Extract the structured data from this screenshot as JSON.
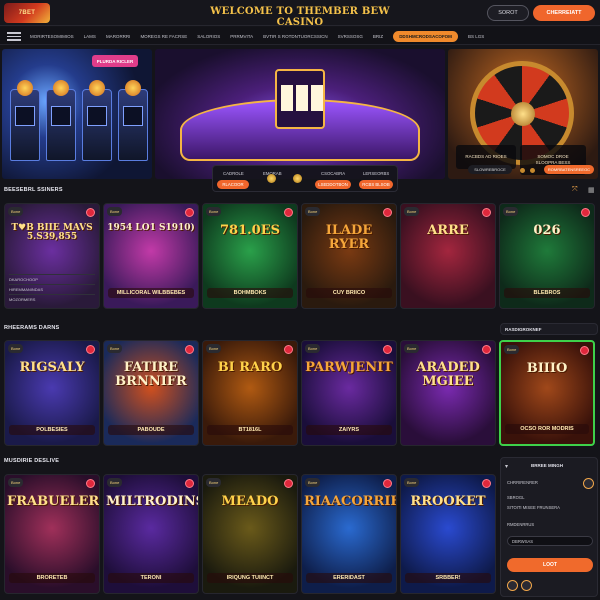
{
  "header": {
    "logo_text": "7BET",
    "title": "WELCOME TO THEMBER BEW CASINO",
    "login_label": "SOROT",
    "register_label": "CHERREIATT"
  },
  "nav": {
    "items": [
      "MORIRTESOMIMIOS",
      "LAMS",
      "MARORRRI",
      "MOREGS RE FACRSE",
      "SALORIOS",
      "PRRMVITA",
      "BVTIR S ROTDNTUORCSSICN",
      "SVRSSOSG",
      "BRIZ",
      "DDSHMCRODSACOFOM",
      "BS LGS"
    ],
    "active_index": 9
  },
  "hero": {
    "promo_tag": "PLURDA RICLER",
    "left_caption": "RACBDS AD RIOES",
    "mid_caption_1": "SOMOC DROE",
    "mid_caption_2": "SLOOPRA BESS",
    "right_pill_1": "SLOWREBROCE",
    "right_pill_2": "ROMRBATENSREEOC",
    "strip_labels": [
      "CADROLE",
      "EMORAB",
      "CSOCABRA",
      "LERSEORBS"
    ],
    "strip_pills": [
      "RLACOOR",
      "LSEDDOTBON",
      "RCBS BLSOB"
    ]
  },
  "sections": {
    "s1_title": "BEESEBRL SSINERS",
    "s2_title": "RHEERAMS DARNS",
    "s3_title": "MUSDIRIE DESLIVE"
  },
  "cards_row1": [
    {
      "badge": "Bone",
      "title": "T♥B BIIE MAVS 5.S39,855",
      "rows": [
        "DKAROCHOOP",
        "HIREMMANINDAS",
        "MOZORMERS"
      ]
    },
    {
      "badge": "Bone",
      "title": "1954 LO1 S1910)",
      "sub": "MILLICORAL WILBBEBES"
    },
    {
      "badge": "Bone",
      "title": "781.0ES",
      "sub": "BOHMBOKS"
    },
    {
      "badge": "Bone",
      "title": "ILADE RYER",
      "sub": "CUY BRIICO"
    },
    {
      "badge": "Bone",
      "title": "ARRE",
      "sub": ""
    },
    {
      "badge": "Bone",
      "title": "026",
      "sub": "BLEBROS"
    }
  ],
  "cards_row2": [
    {
      "badge": "Bone",
      "title": "RIGSALY",
      "sub": "POLBESIES"
    },
    {
      "badge": "Bone",
      "title": "FATIRE BRNNIFR",
      "sub": "PABOUDE"
    },
    {
      "badge": "Bone",
      "title": "BI RARO",
      "sub": "BT1816L"
    },
    {
      "badge": "Bone",
      "title": "PARWJENIT",
      "sub": "ZAIYRS"
    },
    {
      "badge": "Bone",
      "title": "ARADED MGIEE",
      "sub": ""
    },
    {
      "badge": "Bone",
      "title": "BIIIO",
      "sub": "OCSO ROR MODRIS"
    }
  ],
  "cards_row3": [
    {
      "badge": "Bone",
      "title": "FRABUELER",
      "sub": "BRORETEB"
    },
    {
      "badge": "Bone",
      "title": "MILTRODINS",
      "sub": "TERONI"
    },
    {
      "badge": "Bone",
      "title": "MEADO",
      "sub": "IRIQUNG TUIINCT"
    },
    {
      "badge": "Bone",
      "title": "RIAACORRIES",
      "sub": "ERERIDAST"
    },
    {
      "badge": "Bone",
      "title": "RROOKET",
      "sub": "SRBBER!"
    }
  ],
  "side1": {
    "title": "RASDIGROKNEF"
  },
  "side2": {
    "title": "BRREE MINGH",
    "line1": "CHRRIRENRER",
    "line2": "SBROGL",
    "line3": "SITOITI MISEE FRUNSERA",
    "line4": "RMDENRRUS",
    "input": "DBRWSAS",
    "button": "LOOT"
  }
}
